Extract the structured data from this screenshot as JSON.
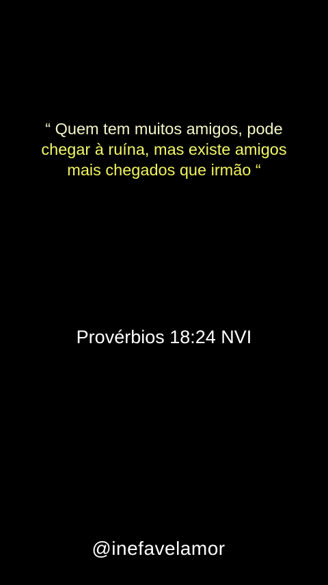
{
  "colors": {
    "background": "#000000",
    "quote_line_1": "#f4f6c8",
    "quote_line_2": "#f2f76a",
    "quote_line_3": "#f0f25e",
    "reference": "#ffffff",
    "handle": "#ffffff"
  },
  "quote": {
    "lines": [
      "“ Quem tem muitos amigos, pode",
      "chegar à ruína, mas existe amigos",
      "mais chegados que irmão “"
    ]
  },
  "reference": "Provérbios 18:24 NVI",
  "handle": "@inefavelamor"
}
